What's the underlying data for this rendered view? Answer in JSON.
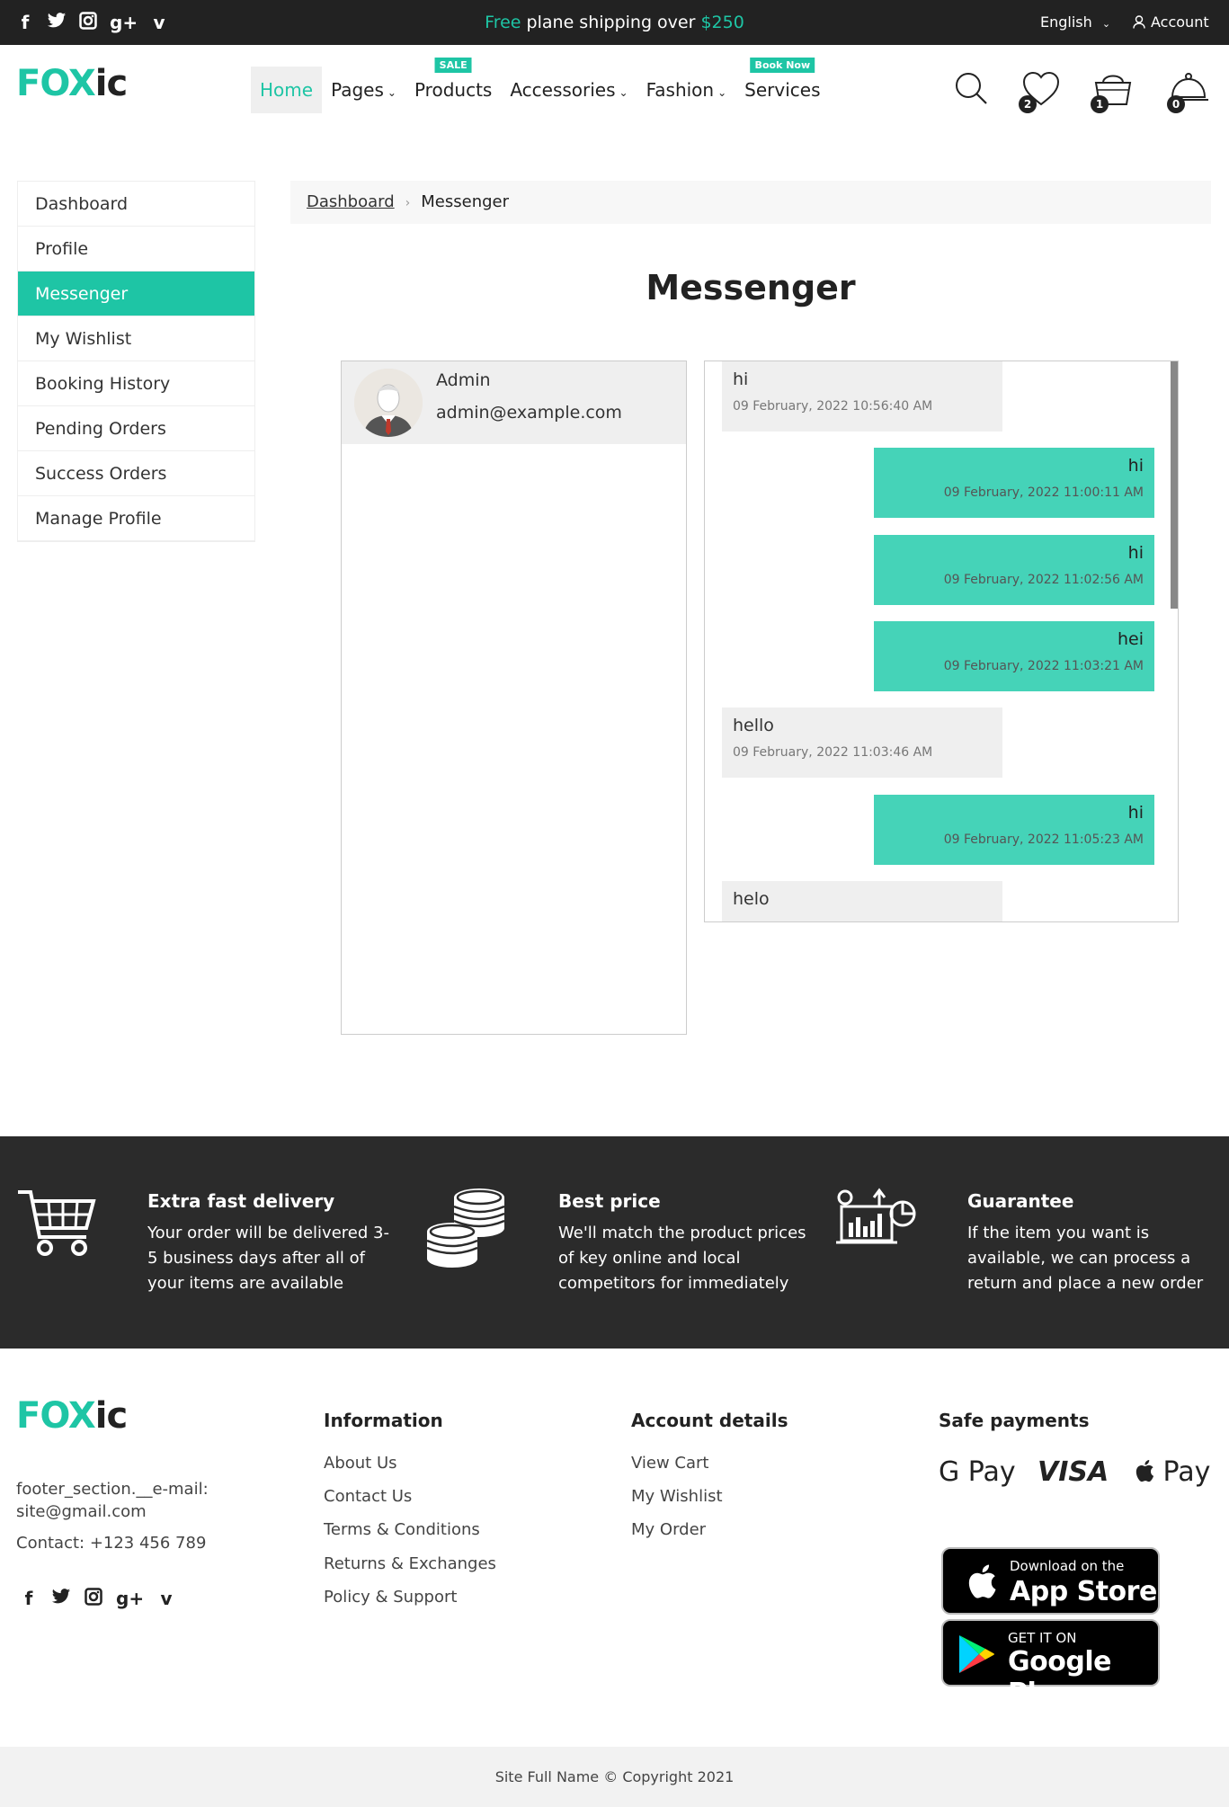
{
  "topbar": {
    "social": [
      "f",
      "t",
      "ig",
      "g+",
      "v"
    ],
    "promo_free": "Free",
    "promo_mid": " plane shipping over ",
    "promo_amount": "$250",
    "language": "English",
    "account": "Account"
  },
  "header": {
    "logo_fox": "FOX",
    "logo_ic": "ic",
    "nav": [
      {
        "label": "Home",
        "badge": ""
      },
      {
        "label": "Pages",
        "badge": ""
      },
      {
        "label": "Products",
        "badge": "SALE"
      },
      {
        "label": "Accessories",
        "badge": ""
      },
      {
        "label": "Fashion",
        "badge": ""
      },
      {
        "label": "Services",
        "badge": "Book Now"
      }
    ],
    "wishlist_count": "2",
    "cart_count": "1",
    "service_count": "0",
    "accent_color": "#1ec5a5"
  },
  "sidebar": {
    "items": [
      "Dashboard",
      "Profile",
      "Messenger",
      "My Wishlist",
      "Booking History",
      "Pending Orders",
      "Success Orders",
      "Manage Profile"
    ]
  },
  "breadcrumb": {
    "root": "Dashboard",
    "current": "Messenger"
  },
  "page_title": "Messenger",
  "contacts": [
    {
      "name": "Admin",
      "email": "admin@example.com"
    }
  ],
  "messages": [
    {
      "text": "hi",
      "time": "09 February, 2022 10:56:40 AM",
      "dir": "in"
    },
    {
      "text": "hi",
      "time": "09 February, 2022 11:00:11 AM",
      "dir": "out"
    },
    {
      "text": "hi",
      "time": "09 February, 2022 11:02:56 AM",
      "dir": "out"
    },
    {
      "text": "hei",
      "time": "09 February, 2022 11:03:21 AM",
      "dir": "out"
    },
    {
      "text": "hello",
      "time": "09 February, 2022 11:03:46 AM",
      "dir": "in"
    },
    {
      "text": "hi",
      "time": "09 February, 2022 11:05:23 AM",
      "dir": "out"
    },
    {
      "text": "helo",
      "time": "",
      "dir": "in"
    }
  ],
  "features": [
    {
      "title": "Extra fast delivery",
      "text": "Your order will be delivered 3-5 business days after all of your items are available"
    },
    {
      "title": "Best price",
      "text": "We'll match the product prices of key online and local competitors for immediately"
    },
    {
      "title": "Guarantee",
      "text": "If the item you want is available, we can process a return and place a new order"
    }
  ],
  "footer": {
    "email_line1": "footer_section.__e-mail:",
    "email_line2": "site@gmail.com",
    "contact": "Contact: +123 456 789",
    "information_title": "Information",
    "information_links": [
      "About Us",
      "Contact Us",
      "Terms & Conditions",
      "Returns & Exchanges",
      "Policy & Support"
    ],
    "account_title": "Account details",
    "account_links": [
      "View Cart",
      "My Wishlist",
      "My Order"
    ],
    "payments_title": "Safe payments",
    "payments": [
      "G Pay",
      "VISA",
      " Pay"
    ],
    "appstore_small": "Download on the",
    "appstore_big": "App Store",
    "googleplay_small": "GET IT ON",
    "googleplay_big": "Google Play",
    "copyright": "Site Full Name © Copyright 2021"
  }
}
